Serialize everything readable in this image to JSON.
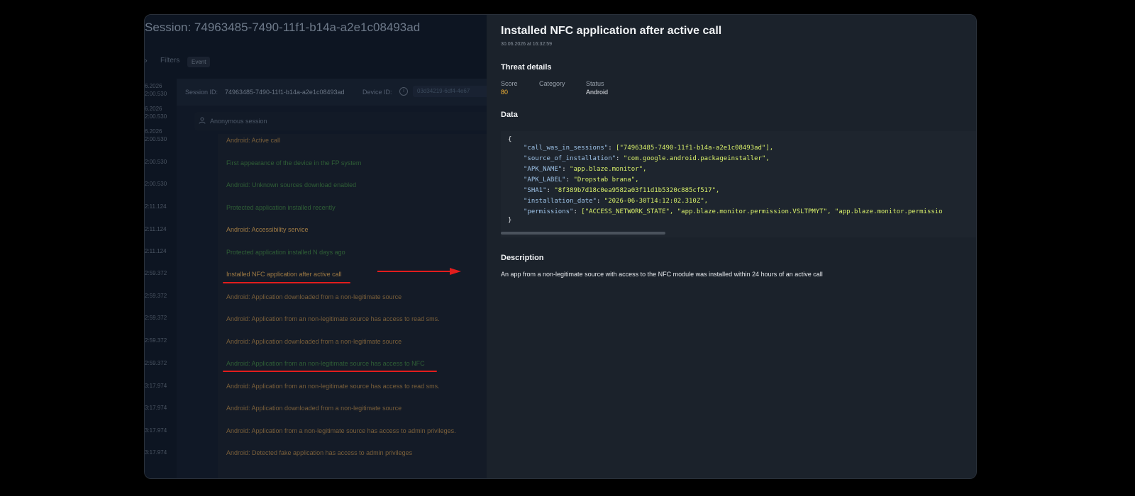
{
  "session": {
    "title": "Session: 74963485-7490-11f1-b14a-a2e1c08493ad",
    "filters_label": "Filters",
    "filter_chip": "Event",
    "session_id_label": "Session ID:",
    "session_id_value": "74963485-7490-11f1-b14a-a2e1c08493ad",
    "device_id_label": "Device ID:",
    "device_id_value": "03d34219-6df4-4e67",
    "anonymous_label": "Anonymous session",
    "times": [
      "6.2026",
      "2:00.530",
      "6.2026",
      "2:00.530",
      "6.2026",
      "2:00.530",
      "2:00.530",
      "2:00.530",
      "2:11.124",
      "2:11.124",
      "2:11.124",
      "2:59.372",
      "2:59.372",
      "2:59.372",
      "2:59.372",
      "2:59.372",
      "3:17.974",
      "3:17.974",
      "3:17.974",
      "3:17.974"
    ],
    "events": [
      {
        "text": "Android: Active call",
        "tone": "orange"
      },
      {
        "text": "First appearance of the device in the FP system",
        "tone": "green"
      },
      {
        "text": "Android: Unknown sources download enabled",
        "tone": "green"
      },
      {
        "text": "Protected application installed recently",
        "tone": "green"
      },
      {
        "text": "Android: Accessibility service",
        "tone": "bright"
      },
      {
        "text": "Protected application installed N days ago",
        "tone": "green"
      },
      {
        "text": "Installed NFC application after active call",
        "tone": "bright"
      },
      {
        "text": "Android: Application downloaded from a non-legitimate source",
        "tone": "orange"
      },
      {
        "text": "Android: Application from an non-legitimate source has access to read sms.",
        "tone": "orange"
      },
      {
        "text": "Android: Application downloaded from a non-legitimate source",
        "tone": "orange"
      },
      {
        "text": "Android: Application from an non-legitimate source has access to NFC",
        "tone": "green"
      },
      {
        "text": "Android: Application from an non-legitimate source has access to read sms.",
        "tone": "orange"
      },
      {
        "text": "Android: Application downloaded from a non-legitimate source",
        "tone": "orange"
      },
      {
        "text": "Android: Application from a non-legitimate source has access to admin privileges.",
        "tone": "orange"
      },
      {
        "text": "Android: Detected fake application has access to admin privileges",
        "tone": "orange"
      }
    ]
  },
  "detail": {
    "title": "Installed NFC application after active call",
    "date": "30.06.2026 at 16:32:59",
    "threat_heading": "Threat details",
    "score_label": "Score",
    "score_value": "80",
    "category_label": "Category",
    "status_label": "Status",
    "status_value": "Android",
    "data_heading": "Data",
    "code": {
      "open": "{",
      "close": "}",
      "lines": [
        {
          "key": "\"call_was_in_sessions\"",
          "value": "[\"74963485-7490-11f1-b14a-a2e1c08493ad\"],"
        },
        {
          "key": "\"source_of_installation\"",
          "value": "\"com.google.android.packageinstaller\","
        },
        {
          "key": "\"APK_NAME\"",
          "value": "\"app.blaze.monitor\","
        },
        {
          "key": "\"APK_LABEL\"",
          "value": "\"Dropstab brana\","
        },
        {
          "key": "\"SHA1\"",
          "value": "\"8f389b7d18c0ea9582a03f11d1b5320c885cf517\","
        },
        {
          "key": "\"installation_date\"",
          "value": "\"2026-06-30T14:12:02.310Z\","
        },
        {
          "key": "\"permissions\"",
          "value": "[\"ACCESS_NETWORK_STATE\", \"app.blaze.monitor.permission.VSLTPMYT\", \"app.blaze.monitor.permissio"
        }
      ]
    },
    "description_heading": "Description",
    "description": "An app from a non-legitimate source with access to the NFC module was installed within 24 hours of an active call"
  },
  "colors": {
    "score": "#f3b335",
    "annotation": "#e11d1d"
  },
  "icons": {
    "user": "user-icon",
    "info": "info-icon",
    "arrow": "red-arrow-annotation"
  }
}
